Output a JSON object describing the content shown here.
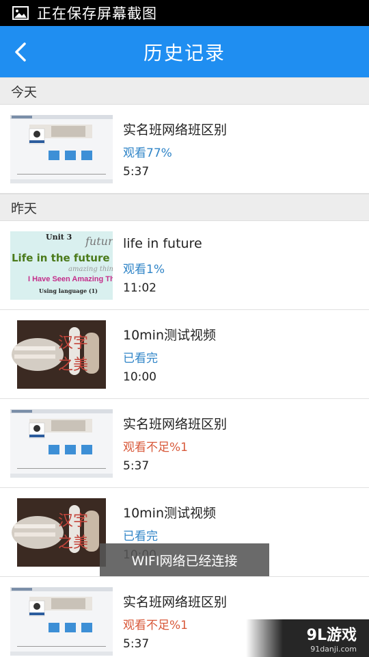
{
  "status_bar": {
    "text": "正在保存屏幕截图",
    "icon": "image-icon"
  },
  "header": {
    "title": "历史记录",
    "back_icon": "chevron-left-icon"
  },
  "sections": [
    {
      "label": "今天",
      "items": [
        {
          "title": "实名班网络班区别",
          "progress": "观看77%",
          "duration": "5:37",
          "thumb": "screenshot",
          "progress_color": "blue"
        }
      ]
    },
    {
      "label": "昨天",
      "items": [
        {
          "title": "life in future",
          "progress": "观看1%",
          "duration": "11:02",
          "thumb": "unit3",
          "progress_color": "blue"
        },
        {
          "title": "10min测试视频",
          "progress": "已看完",
          "duration": "10:00",
          "thumb": "book",
          "progress_color": "blue"
        },
        {
          "title": "实名班网络班区别",
          "progress": "观看不足%1",
          "duration": "5:37",
          "thumb": "screenshot",
          "progress_color": "red"
        },
        {
          "title": "10min测试视频",
          "progress": "已看完",
          "duration": "10:00",
          "thumb": "book",
          "progress_color": "blue"
        },
        {
          "title": "实名班网络班区别",
          "progress": "观看不足%1",
          "duration": "5:37",
          "thumb": "screenshot",
          "progress_color": "red"
        }
      ]
    }
  ],
  "thumb_text": {
    "unit3": {
      "unit": "Unit 3",
      "line1": "Life in the future",
      "line2": "I Have Seen Amazing Things",
      "line3": "Using language (1)"
    },
    "book": {
      "calligraphy": "汉字之美"
    }
  },
  "toast": {
    "text": "WIFI网络已经连接"
  },
  "watermark": {
    "main": "9L游戏",
    "sub": "91danji.com"
  },
  "colors": {
    "header": "#1f8ef1",
    "blue_text": "#2f84c7",
    "red_text": "#d8593a",
    "section_bg": "#ededed"
  }
}
